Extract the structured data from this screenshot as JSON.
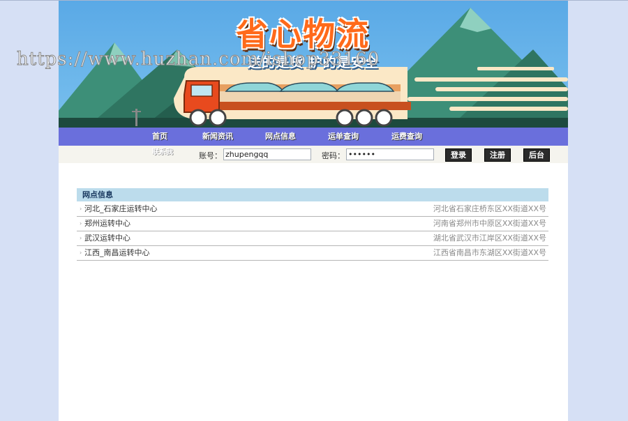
{
  "watermark": "https://www.huzhan.com/ishop33160",
  "banner": {
    "title": "省心物流",
    "slogan": "送的是货 护的是安全"
  },
  "nav": {
    "items": [
      {
        "label": "首页"
      },
      {
        "label": "新闻资讯"
      },
      {
        "label": "网点信息"
      },
      {
        "label": "运单查询"
      },
      {
        "label": "运费查询"
      }
    ],
    "sub_label": "联系我"
  },
  "login": {
    "account_label": "账号：",
    "account_value": "zhupengqq",
    "password_label": "密码：",
    "password_value": "••••••",
    "login_button": "登录",
    "register_button": "注册",
    "admin_button": "后台"
  },
  "outlets": {
    "title": "网点信息",
    "rows": [
      {
        "bullet": "›",
        "name": "河北_石家庄运转中心",
        "address": "河北省石家庄桥东区XX街道XX号"
      },
      {
        "bullet": "›",
        "name": "郑州运转中心",
        "address": "河南省郑州市中原区XX街道XX号"
      },
      {
        "bullet": "›",
        "name": "武汉运转中心",
        "address": "湖北省武汉市江岸区XX街道XX号"
      },
      {
        "bullet": "›",
        "name": "江西_南昌运转中心",
        "address": "江西省南昌市东湖区XX街道XX号"
      }
    ]
  },
  "colors": {
    "background": "#d6e0f5",
    "nav": "#6a6fdc",
    "panel_header": "#bcdcec",
    "title_orange": "#ff6a1a"
  }
}
